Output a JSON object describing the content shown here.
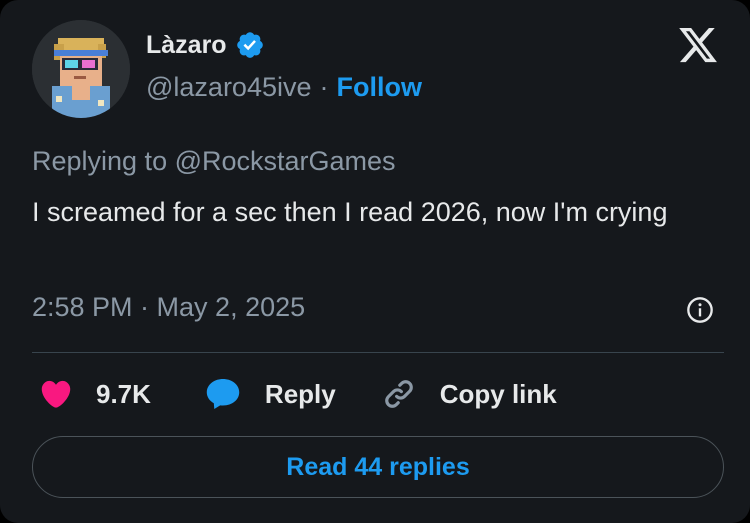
{
  "user": {
    "display_name": "Làzaro",
    "handle": "@lazaro45ive",
    "separator": "·",
    "follow_label": "Follow",
    "verified_icon": "verified-badge-icon"
  },
  "tweet": {
    "replying_to": "Replying to @RockstarGames",
    "text": "I screamed for a sec then I read 2026, now I'm crying",
    "timestamp": "2:58 PM · May 2, 2025"
  },
  "actions": {
    "likes_count": "9.7K",
    "reply_label": "Reply",
    "copy_link_label": "Copy link",
    "read_replies_label": "Read 44 replies"
  },
  "icons": {
    "logo": "x-logo-icon",
    "info": "info-icon",
    "like": "heart-icon",
    "reply": "comment-bubble-icon",
    "copy": "link-icon"
  },
  "colors": {
    "background": "#15181c",
    "accent": "#1d9bf0",
    "like": "#f91880",
    "muted_text": "#8b98a5",
    "primary_text": "#e7e9ea"
  }
}
